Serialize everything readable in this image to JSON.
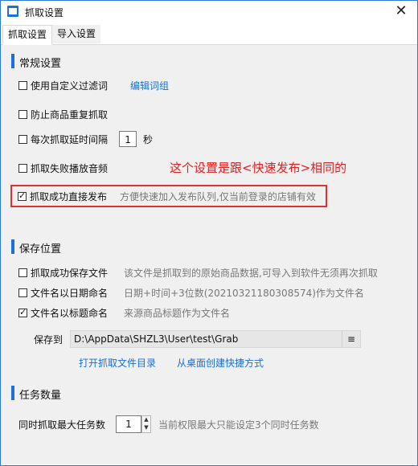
{
  "window": {
    "title": "抓取设置",
    "close_glyph": "✕"
  },
  "tabs": [
    {
      "label": "抓取设置",
      "active": true
    },
    {
      "label": "导入设置",
      "active": false
    }
  ],
  "general": {
    "title": "常规设置",
    "custom_filter": {
      "label": "使用自定义过滤词",
      "checked": false,
      "link": "编辑词组"
    },
    "prevent_duplicate": {
      "label": "防止商品重复抓取",
      "checked": false
    },
    "delay": {
      "label": "每次抓取延时间隔",
      "checked": false,
      "value": "1",
      "unit": "秒"
    },
    "fail_sound": {
      "label": "抓取失败播放音频",
      "checked": false
    },
    "note": "这个设置是跟<快速发布>相同的",
    "direct_publish": {
      "label": "抓取成功直接发布",
      "checked": true,
      "hint": "方便快速加入发布队列,仅当前登录的店铺有效"
    }
  },
  "save": {
    "title": "保存位置",
    "save_file": {
      "label": "抓取成功保存文件",
      "checked": false,
      "hint": "该文件是抓取到的原始商品数据,可导入到软件无须再次抓取"
    },
    "name_by_date": {
      "label": "文件名以日期命名",
      "checked": false,
      "hint": "日期+时间+3位数(20210321180308574)作为文件名"
    },
    "name_by_title": {
      "label": "文件名以标题命名",
      "checked": true,
      "hint": "来源商品标题作为文件名"
    },
    "save_to_label": "保存到",
    "path": "D:\\AppData\\SHZL3\\User\\test\\Grab",
    "menu_glyph": "≡",
    "open_dir_link": "打开抓取文件目录",
    "shortcut_link": "从桌面创建快捷方式"
  },
  "tasks": {
    "title": "任务数量",
    "max_label": "同时抓取最大任务数",
    "value": "1",
    "hint": "当前权限最大只能设定3个同时任务数"
  },
  "colors": {
    "accent": "#1e6fd9",
    "link": "#1a6fd0",
    "note": "#e02020"
  }
}
